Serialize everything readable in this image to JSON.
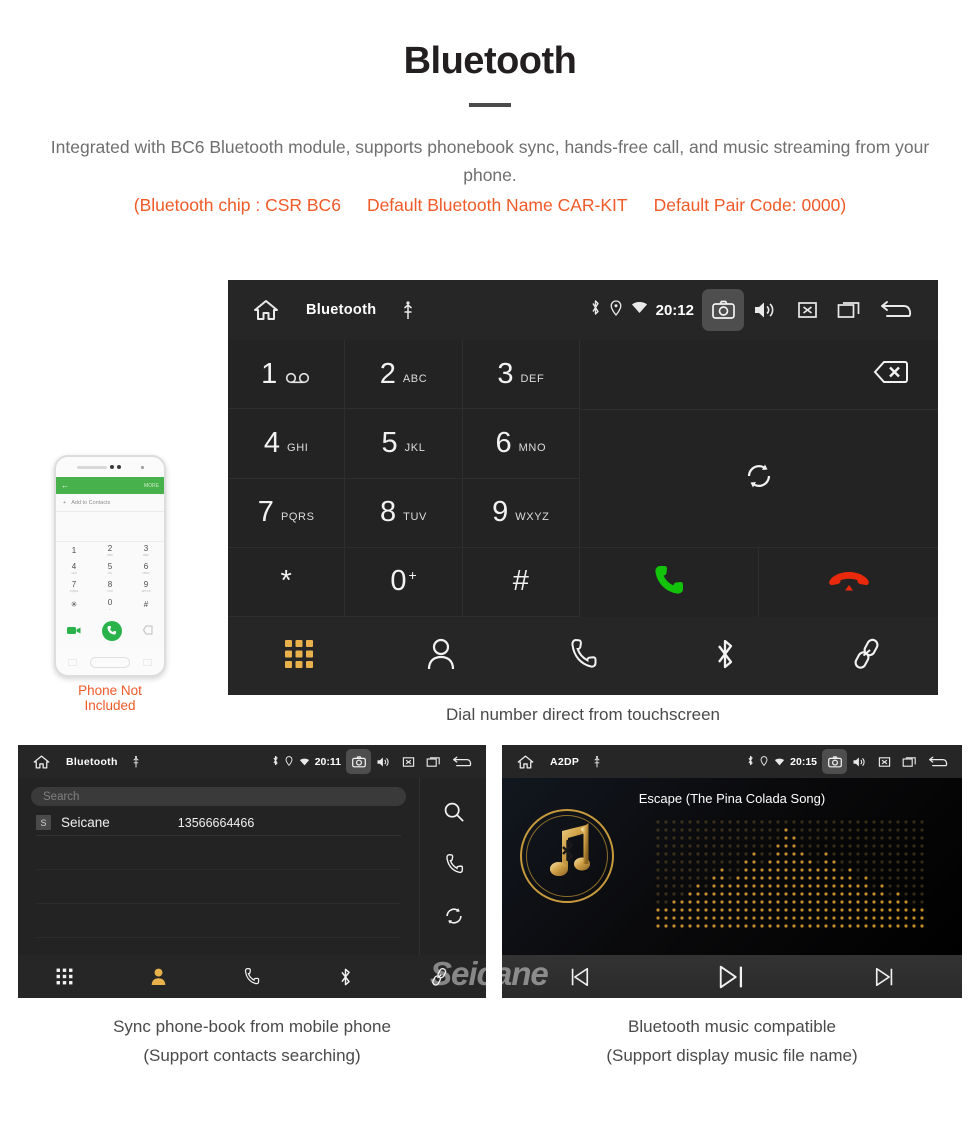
{
  "header": {
    "title": "Bluetooth",
    "intro": "Integrated with BC6 Bluetooth module, supports phonebook sync, hands-free call, and music streaming from your phone.",
    "spec_chip": "(Bluetooth chip : CSR BC6",
    "spec_name": "Default Bluetooth Name CAR-KIT",
    "spec_pair": "Default Pair Code: 0000)"
  },
  "colors": {
    "accent_orange": "#f05a28",
    "gold": "#e8b14c",
    "call_green": "#13c20a",
    "end_red": "#e8290b",
    "screen_bg": "#232323",
    "statusbar_bg": "#262626"
  },
  "dialer": {
    "statusbar": {
      "home_icon": "home-icon",
      "title": "Bluetooth",
      "usb_icon": "usb-icon",
      "bt_icon": "bluetooth-icon",
      "gps_icon": "location-icon",
      "wifi_icon": "wifi-icon",
      "clock": "20:12",
      "camera_icon": "camera-icon",
      "volume_icon": "volume-icon",
      "mute_icon": "mute-icon",
      "recents_icon": "recents-icon",
      "back_icon": "back-icon"
    },
    "keys": [
      {
        "num": "1",
        "sub": "",
        "icon": "voicemail-icon"
      },
      {
        "num": "2",
        "sub": "ABC",
        "icon": ""
      },
      {
        "num": "3",
        "sub": "DEF",
        "icon": ""
      },
      {
        "num": "4",
        "sub": "GHI",
        "icon": ""
      },
      {
        "num": "5",
        "sub": "JKL",
        "icon": ""
      },
      {
        "num": "6",
        "sub": "MNO",
        "icon": ""
      },
      {
        "num": "7",
        "sub": "PQRS",
        "icon": ""
      },
      {
        "num": "8",
        "sub": "TUV",
        "icon": ""
      },
      {
        "num": "9",
        "sub": "WXYZ",
        "icon": ""
      },
      {
        "num": "*",
        "sub": "",
        "icon": ""
      },
      {
        "num": "0",
        "sup": "+",
        "sub": "",
        "icon": ""
      },
      {
        "num": "#",
        "sub": "",
        "icon": ""
      }
    ],
    "actions": {
      "backspace_icon": "backspace-icon",
      "sync_icon": "sync-icon",
      "call_icon": "call-icon",
      "hangup_icon": "hangup-icon"
    },
    "nav": [
      {
        "icon": "keypad-icon",
        "active": true
      },
      {
        "icon": "contacts-icon",
        "active": false
      },
      {
        "icon": "call-log-icon",
        "active": false
      },
      {
        "icon": "bluetooth-icon",
        "active": false
      },
      {
        "icon": "link-icon",
        "active": false
      }
    ],
    "caption": "Dial number direct from touchscreen"
  },
  "phone_mock": {
    "back_arrow": "←",
    "more_label": "MORE",
    "add_contacts": "Add to Contacts",
    "plus": "+",
    "keys": [
      {
        "num": "1",
        "sub": ""
      },
      {
        "num": "2",
        "sub": "ABC"
      },
      {
        "num": "3",
        "sub": "DEF"
      },
      {
        "num": "4",
        "sub": "GHI"
      },
      {
        "num": "5",
        "sub": "JKL"
      },
      {
        "num": "6",
        "sub": "MNO"
      },
      {
        "num": "7",
        "sub": "PQRS"
      },
      {
        "num": "8",
        "sub": "TUV"
      },
      {
        "num": "9",
        "sub": "WXYZ"
      },
      {
        "num": "✳",
        "sub": ""
      },
      {
        "num": "0",
        "sub": "+"
      },
      {
        "num": "#",
        "sub": ""
      }
    ],
    "note": "Phone Not Included"
  },
  "phonebook": {
    "statusbar": {
      "title": "Bluetooth",
      "clock": "20:11"
    },
    "search_placeholder": "Search",
    "contacts": [
      {
        "initial": "S",
        "name": "Seicane",
        "number": "13566664466"
      }
    ],
    "side_icons": [
      "search-icon",
      "call-icon",
      "sync-icon"
    ],
    "nav": [
      {
        "icon": "keypad-icon",
        "active": false
      },
      {
        "icon": "contacts-icon",
        "active": true
      },
      {
        "icon": "call-log-icon",
        "active": false
      },
      {
        "icon": "bluetooth-icon",
        "active": false
      },
      {
        "icon": "link-icon",
        "active": false
      }
    ],
    "caption_line1": "Sync phone-book from mobile phone",
    "caption_line2": "(Support contacts searching)"
  },
  "music": {
    "statusbar": {
      "title": "A2DP",
      "clock": "20:15"
    },
    "track_title": "Escape (The Pina Colada Song)",
    "album_icon": "bluetooth-music-note-icon",
    "controls": [
      {
        "icon": "previous-icon"
      },
      {
        "icon": "play-pause-icon"
      },
      {
        "icon": "next-icon"
      }
    ],
    "caption_line1": "Bluetooth music compatible",
    "caption_line2": "(Support display music file name)"
  },
  "watermark": "Seicane"
}
